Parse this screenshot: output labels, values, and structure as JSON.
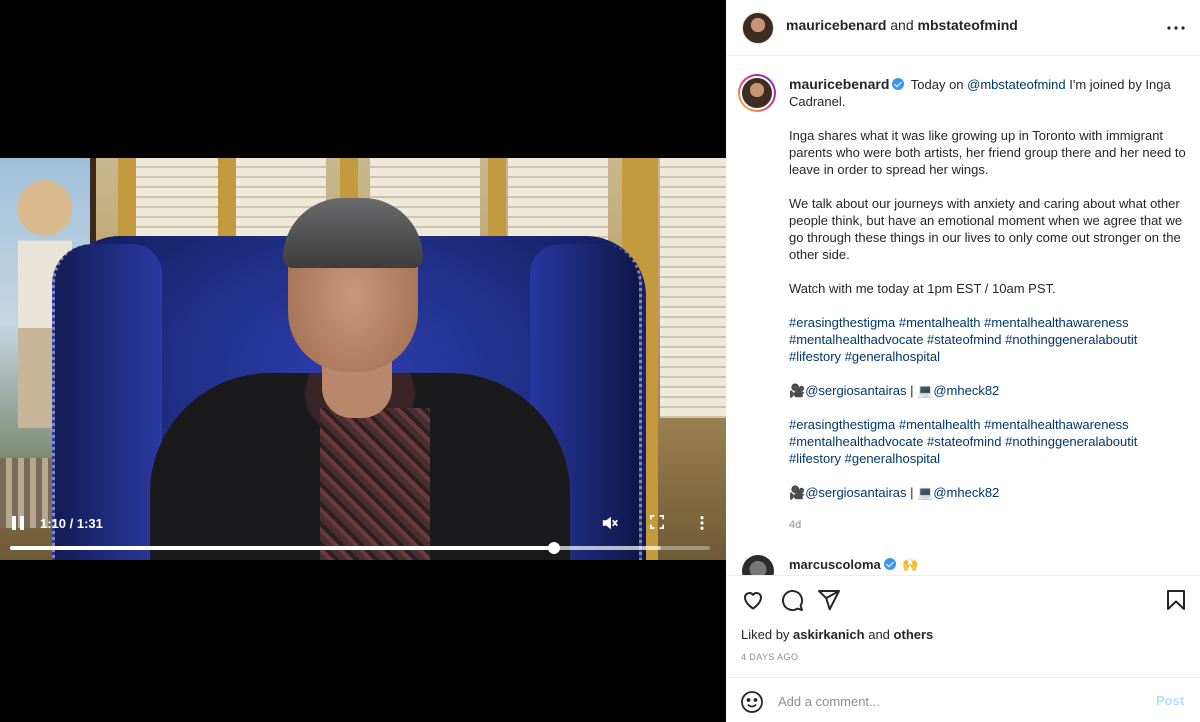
{
  "video": {
    "time_readout": "1:10 / 1:31",
    "progress_fraction": 0.7766,
    "buffered_fraction": 0.93,
    "icons": {
      "pause": "pause-icon",
      "mute": "volume-muted-icon",
      "fullscreen": "fullscreen-icon",
      "more": "more-vertical-icon"
    }
  },
  "header": {
    "user1": "mauricebenard",
    "joiner": "and",
    "user2": "mbstateofmind"
  },
  "caption": {
    "username": "mauricebenard",
    "intro_text": "Today on",
    "mention": "@mbstateofmind",
    "intro_rest": "I'm joined by Inga Cadranel.",
    "para1": "Inga shares what it was like growing up in Toronto with immigrant parents who were both artists, her friend group there and her need to leave in order to spread her wings.",
    "para2": "We talk about our journeys with anxiety and caring about what other people think, but have an emotional moment when we agree that we go through these things in our lives to only come out stronger on the other side.",
    "para3": "Watch with me today at 1pm EST / 10am PST.",
    "hashtags1": "#erasingthestigma #mentalhealth #mentalhealthawareness #mentalhealthadvocate #stateofmind #nothinggeneralaboutit #lifestory #generalhospital",
    "credit_camera_icon": "🎥",
    "credit_user1": "@sergiosantairas",
    "credit_sep": " | ",
    "credit_laptop_icon": "💻",
    "credit_user2": "@mheck82",
    "hashtags2": "#erasingthestigma #mentalhealth #mentalhealthawareness #mentalhealthadvocate #stateofmind #nothinggeneralaboutit #lifestory #generalhospital",
    "age": "4d"
  },
  "first_comment": {
    "username": "marcuscoloma",
    "emoji": "🙌"
  },
  "likes": {
    "prefix": "Liked by",
    "user": "askirkanich",
    "joiner": "and",
    "others": "others"
  },
  "date": "4 DAYS AGO",
  "comment_box": {
    "placeholder": "Add a comment...",
    "post_label": "Post"
  },
  "colors": {
    "link": "#00376b",
    "verified": "#3897f0",
    "post_button_disabled": "#b2dffc",
    "muted_text": "#8e8e8e"
  }
}
